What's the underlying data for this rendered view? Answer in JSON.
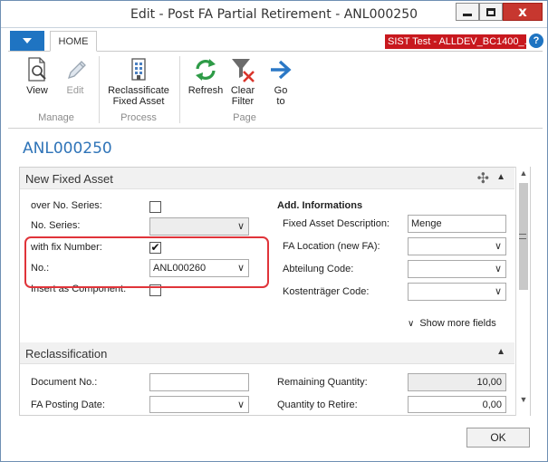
{
  "window": {
    "title": "Edit - Post FA Partial Retirement - ANL000250",
    "close_glyph": "x"
  },
  "ribbon": {
    "tab_home": "HOME",
    "company": "SIST Test - ALLDEV_BC1400_...",
    "help": "?",
    "groups": {
      "manage": "Manage",
      "process": "Process",
      "page": "Page"
    },
    "buttons": {
      "view": "View",
      "edit": "Edit",
      "reclassificate_line1": "Reclassificate",
      "reclassificate_line2": "Fixed Asset",
      "refresh": "Refresh",
      "clear_filter_line1": "Clear",
      "clear_filter_line2": "Filter",
      "go_to_line1": "Go",
      "go_to_line2": "to"
    }
  },
  "record": {
    "title": "ANL000250"
  },
  "new_fixed_asset": {
    "header": "New Fixed Asset",
    "over_no_series_label": "over No. Series:",
    "over_no_series_checked": false,
    "no_series_label": "No. Series:",
    "no_series_value": "",
    "with_fix_number_label": "with fix Number:",
    "with_fix_number_checked": true,
    "no_label": "No.:",
    "no_value": "ANL000260",
    "insert_as_component_label": "Insert as Component:",
    "insert_as_component_checked": false,
    "add_info_header": "Add. Informations",
    "fa_description_label": "Fixed Asset Description:",
    "fa_description_value": "Menge",
    "fa_location_label": "FA Location (new FA):",
    "fa_location_value": "",
    "abteilung_label": "Abteilung Code:",
    "abteilung_value": "",
    "kostentraeger_label": "Kostenträger Code:",
    "kostentraeger_value": "",
    "show_more": "Show more fields"
  },
  "reclassification": {
    "header": "Reclassification",
    "document_no_label": "Document No.:",
    "document_no_value": "",
    "fa_posting_date_label": "FA Posting Date:",
    "fa_posting_date_value": "",
    "remaining_qty_label": "Remaining Quantity:",
    "remaining_qty_value": "10,00",
    "qty_to_retire_label": "Quantity to Retire:",
    "qty_to_retire_value": "0,00"
  },
  "footer": {
    "ok": "OK"
  },
  "colors": {
    "accent": "#1f74c2",
    "company_badge": "#c8181e",
    "highlight_box": "#e0343a",
    "record_title": "#2f74b8"
  },
  "icons": [
    "view-icon",
    "edit-icon",
    "reclassificate-icon",
    "refresh-icon",
    "clear-filter-icon",
    "go-to-icon",
    "gear-icon",
    "chevron-down-icon",
    "chevron-up-icon",
    "help-icon"
  ]
}
